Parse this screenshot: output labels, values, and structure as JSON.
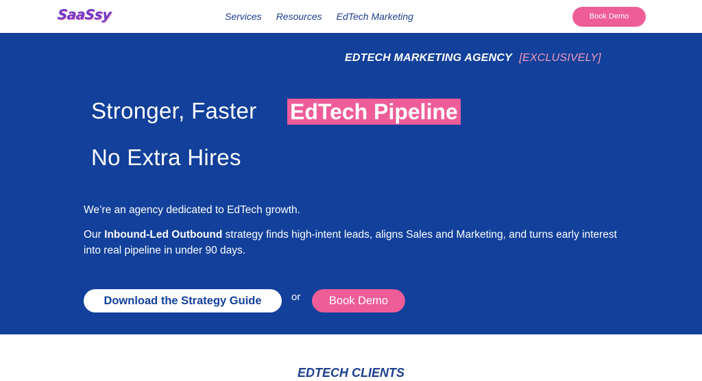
{
  "nav": {
    "logo": "SaaSsy",
    "items": [
      {
        "label": "Services"
      },
      {
        "label": "Resources"
      },
      {
        "label": "EdTech Marketing"
      }
    ],
    "cta": "Book Demo"
  },
  "hero": {
    "kicker": "EDTECH MARKETING AGENCY",
    "kicker_accent": "[EXCLUSIVELY]",
    "headline_start": "Stronger, Faster",
    "headline_highlight": "EdTech Pipeline",
    "headline_line2": "No Extra Hires",
    "intro": "We’re an agency dedicated to EdTech growth.",
    "body_prefix": "Our",
    "body_bold": "Inbound-Led Outbound",
    "body_rest": "strategy finds high-intent leads, aligns Sales and Marketing, and turns early interest into real pipeline in under 90 days.",
    "cta_primary": "Download the Strategy Guide",
    "or_text": "or",
    "cta_secondary": "Book Demo"
  },
  "clients": {
    "title": "EDTECH CLIENTS"
  },
  "colors": {
    "brand_blue": "#12409a",
    "accent_pink": "#ee5d98",
    "nav_text": "#1d3f8f"
  }
}
